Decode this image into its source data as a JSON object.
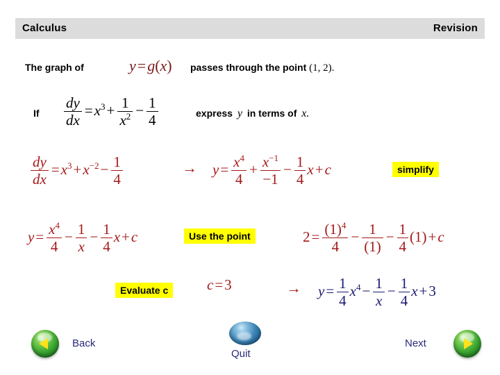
{
  "header": {
    "title": "Calculus",
    "subtitle": "Revision"
  },
  "statement": {
    "lead": "The graph of",
    "function_math": "y = g(x)",
    "tail": "passes through the point",
    "point": "(1, 2)."
  },
  "given": {
    "if_label": "If",
    "derivative_lhs": "dy",
    "derivative_lhs_den": "dx",
    "derivative_rhs": "x^3 + 1/x^2 - 1/4",
    "instruction_pre": "express",
    "instruction_var1": "y",
    "instruction_mid": "in terms of",
    "instruction_var2": "x."
  },
  "work": {
    "line1_label": "dy/dx = x^3 + x^-2 - 1/4",
    "line1_result": "y = x^4/4 + x^-1/-1 - (1/4)x + c",
    "line2_label": "y = x^4/4 - 1/x - (1/4)x + c",
    "line3_substitution": "2 = (1)^4/4 - 1/(1) - (1/4)(1) + c",
    "line4_value": "c = 3",
    "line5_answer": "y = (1/4)x^4 - 1/x - (1/4)x + 3",
    "arrow": "→"
  },
  "callouts": {
    "simplify": "simplify",
    "use_the_point": "Use the point",
    "evaluate_c": "Evaluate c"
  },
  "nav": {
    "back": "Back",
    "quit": "Quit",
    "next": "Next"
  },
  "colors": {
    "header_bar": "#dcdcdc",
    "work_red": "#a51818",
    "answer_blue": "#1a1a70",
    "highlight_yellow": "#ffff00",
    "nav_label": "#29297a"
  }
}
